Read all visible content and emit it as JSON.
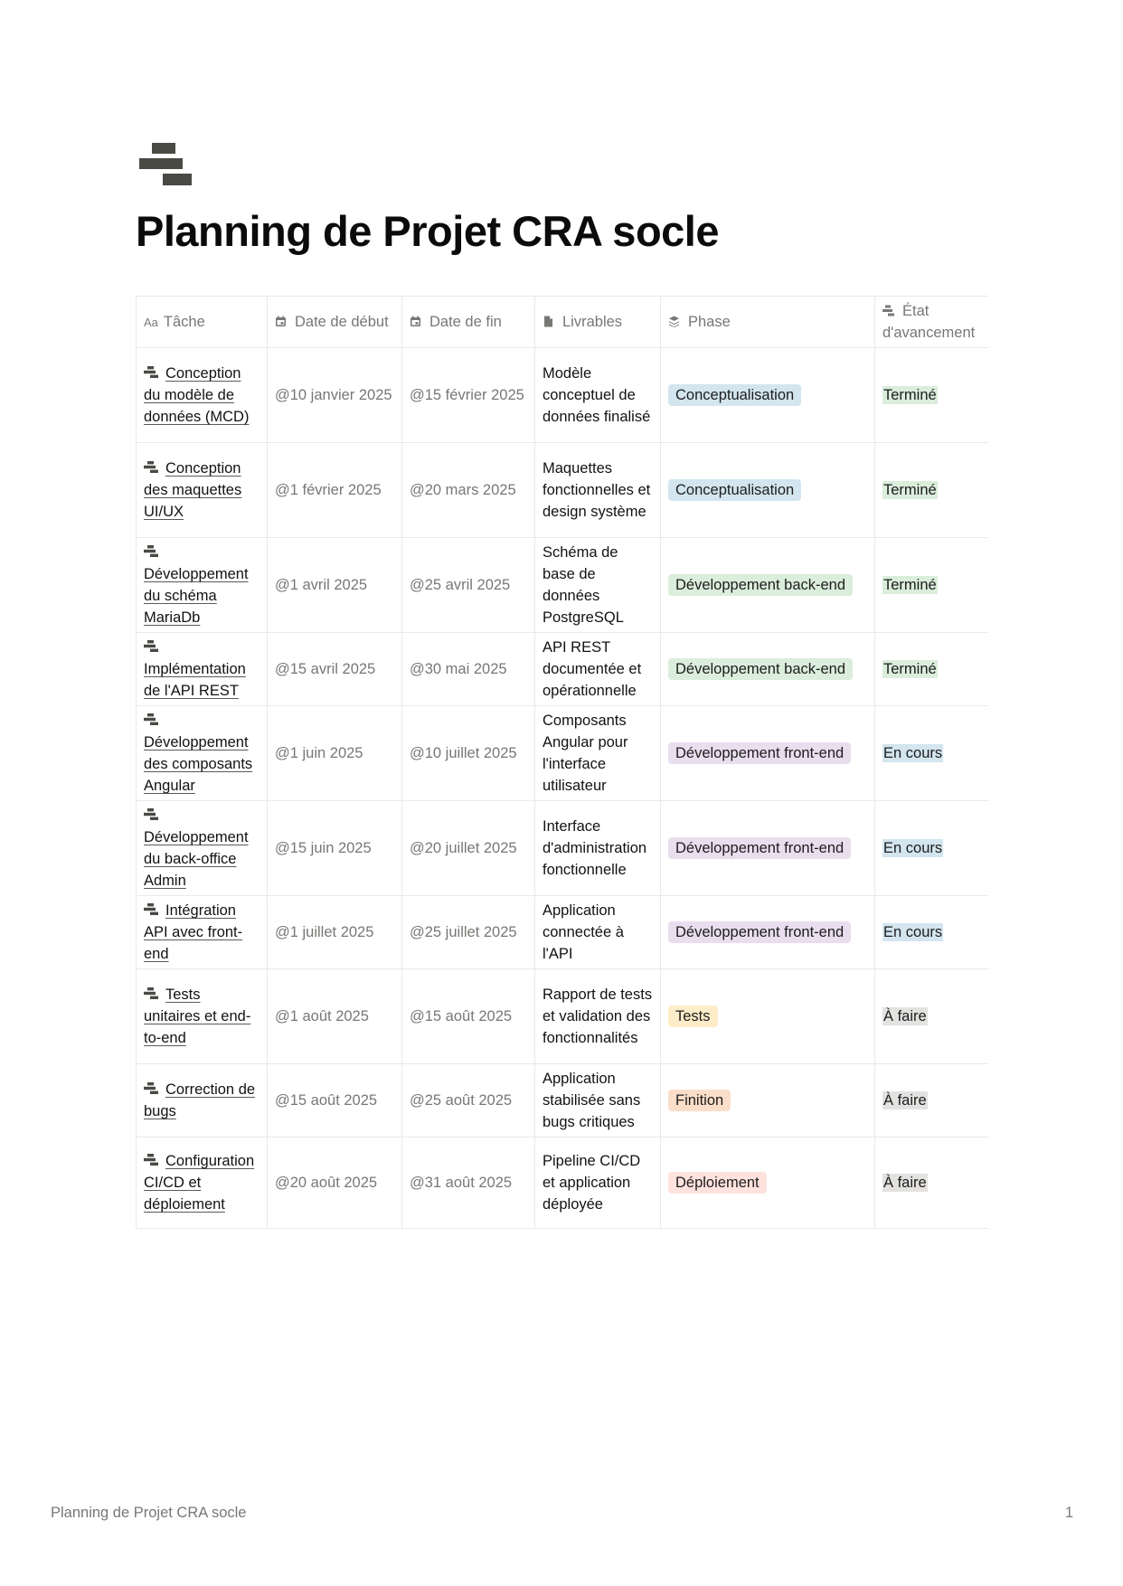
{
  "page": {
    "title": "Planning de Projet CRA socle",
    "icon": "stacked-bars-icon"
  },
  "table": {
    "headers": [
      {
        "label": "Tâche",
        "icon": "Aa"
      },
      {
        "label": "Date de début",
        "icon": "calendar-icon"
      },
      {
        "label": "Date de fin",
        "icon": "calendar-icon"
      },
      {
        "label": "Livrables",
        "icon": "document-icon"
      },
      {
        "label": "Phase",
        "icon": "layers-icon"
      },
      {
        "label": "État d'avancement",
        "icon": "stacked-bars-icon"
      }
    ],
    "rows": [
      {
        "task": "Conception du modèle de données (MCD)",
        "start": "@10 janvier 2025",
        "end": "@15 février 2025",
        "deliverable": "Modèle conceptuel de données finalisé",
        "phase": "Conceptualisation",
        "status": "Terminé"
      },
      {
        "task": "Conception des maquettes UI/UX",
        "start": "@1 février 2025",
        "end": "@20 mars 2025",
        "deliverable": "Maquettes fonctionnelles et design système",
        "phase": "Conceptualisation",
        "status": "Terminé"
      },
      {
        "task": "Développement du schéma MariaDb",
        "start": "@1 avril 2025",
        "end": "@25 avril 2025",
        "deliverable": "Schéma de base de données PostgreSQL",
        "phase": "Développement back-end",
        "status": "Terminé"
      },
      {
        "task": "Implémentation de l'API REST",
        "start": "@15 avril 2025",
        "end": "@30 mai 2025",
        "deliverable": "API REST documentée et opérationnelle",
        "phase": "Développement back-end",
        "status": "Terminé"
      },
      {
        "task": "Développement des composants Angular",
        "start": "@1 juin 2025",
        "end": "@10 juillet 2025",
        "deliverable": "Composants Angular pour l'interface utilisateur",
        "phase": "Développement front-end",
        "status": "En cours"
      },
      {
        "task": "Développement du back-office Admin",
        "start": "@15 juin 2025",
        "end": "@20 juillet 2025",
        "deliverable": "Interface d'administration fonctionnelle",
        "phase": "Développement front-end",
        "status": "En cours"
      },
      {
        "task": "Intégration API avec front-end",
        "start": "@1 juillet 2025",
        "end": "@25 juillet 2025",
        "deliverable": "Application connectée à l'API",
        "phase": "Développement front-end",
        "status": "En cours"
      },
      {
        "task": "Tests unitaires et end-to-end",
        "start": "@1 août 2025",
        "end": "@15 août 2025",
        "deliverable": "Rapport de tests et validation des fonctionnalités",
        "phase": "Tests",
        "status": "À faire"
      },
      {
        "task": "Correction de bugs",
        "start": "@15 août 2025",
        "end": "@25 août 2025",
        "deliverable": "Application stabilisée sans bugs critiques",
        "phase": "Finition",
        "status": "À faire"
      },
      {
        "task": "Configuration CI/CD et déploiement",
        "start": "@20 août 2025",
        "end": "@31 août 2025",
        "deliverable": "Pipeline CI/CD et application déployée",
        "phase": "Déploiement",
        "status": "À faire"
      }
    ]
  },
  "phase_colors": {
    "Conceptualisation": "#d3e5ef",
    "Développement back-end": "#dbeddb",
    "Développement front-end": "#e8deee",
    "Tests": "#fdecc8",
    "Finition": "#fadec9",
    "Déploiement": "#ffe2dd"
  },
  "status_colors": {
    "Terminé": "#dbeddb",
    "En cours": "#d3e5ef",
    "À faire": "#e3e2e0"
  },
  "footer": {
    "title": "Planning de Projet CRA socle",
    "page_number": "1"
  }
}
